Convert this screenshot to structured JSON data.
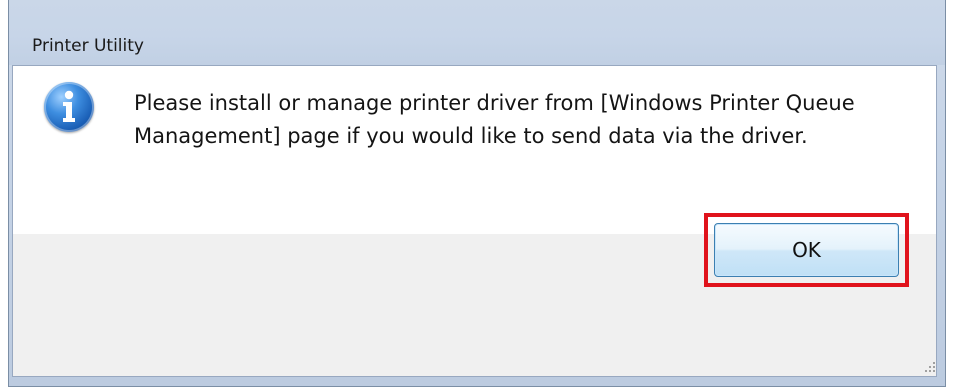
{
  "window": {
    "title": "Printer Utility"
  },
  "message": {
    "icon": "information-icon",
    "text": "Please install or manage printer driver from [Windows Printer Queue Management] page if you would like to send data via the driver."
  },
  "buttons": {
    "ok_label": "OK"
  },
  "colors": {
    "highlight": "#e0131c",
    "title_bar": "#c7d5e8",
    "button_border": "#3c7fb1"
  }
}
